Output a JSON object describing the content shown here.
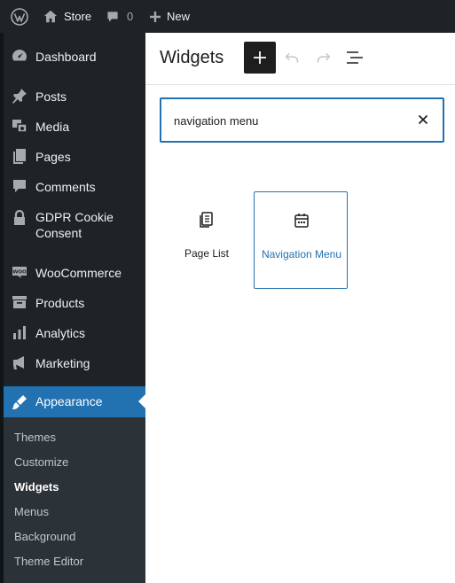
{
  "adminbar": {
    "site_name": "Store",
    "comments_count": "0",
    "new_label": "New"
  },
  "sidebar": {
    "items": [
      {
        "label": "Dashboard",
        "icon": "dashboard-icon"
      },
      {
        "label": "Posts",
        "icon": "pushpin-icon"
      },
      {
        "label": "Media",
        "icon": "media-icon"
      },
      {
        "label": "Pages",
        "icon": "pages-icon"
      },
      {
        "label": "Comments",
        "icon": "comment-icon"
      },
      {
        "label": "GDPR Cookie Consent",
        "icon": "lock-icon"
      },
      {
        "label": "WooCommerce",
        "icon": "woo-icon"
      },
      {
        "label": "Products",
        "icon": "archive-icon"
      },
      {
        "label": "Analytics",
        "icon": "bar-chart-icon"
      },
      {
        "label": "Marketing",
        "icon": "megaphone-icon"
      },
      {
        "label": "Appearance",
        "icon": "paintbrush-icon",
        "current": true
      }
    ],
    "submenu": [
      "Themes",
      "Customize",
      "Widgets",
      "Menus",
      "Background",
      "Theme Editor"
    ],
    "submenu_current": "Widgets"
  },
  "editor": {
    "title": "Widgets",
    "search": {
      "value": "navigation menu"
    },
    "results": [
      {
        "label": "Page List",
        "icon": "page-list-icon"
      },
      {
        "label": "Navigation Menu",
        "icon": "navigation-menu-icon",
        "selected": true
      }
    ]
  },
  "colors": {
    "admin_bg": "#1d2327",
    "accent": "#2271b1",
    "submenu_bg": "#2c3338"
  }
}
